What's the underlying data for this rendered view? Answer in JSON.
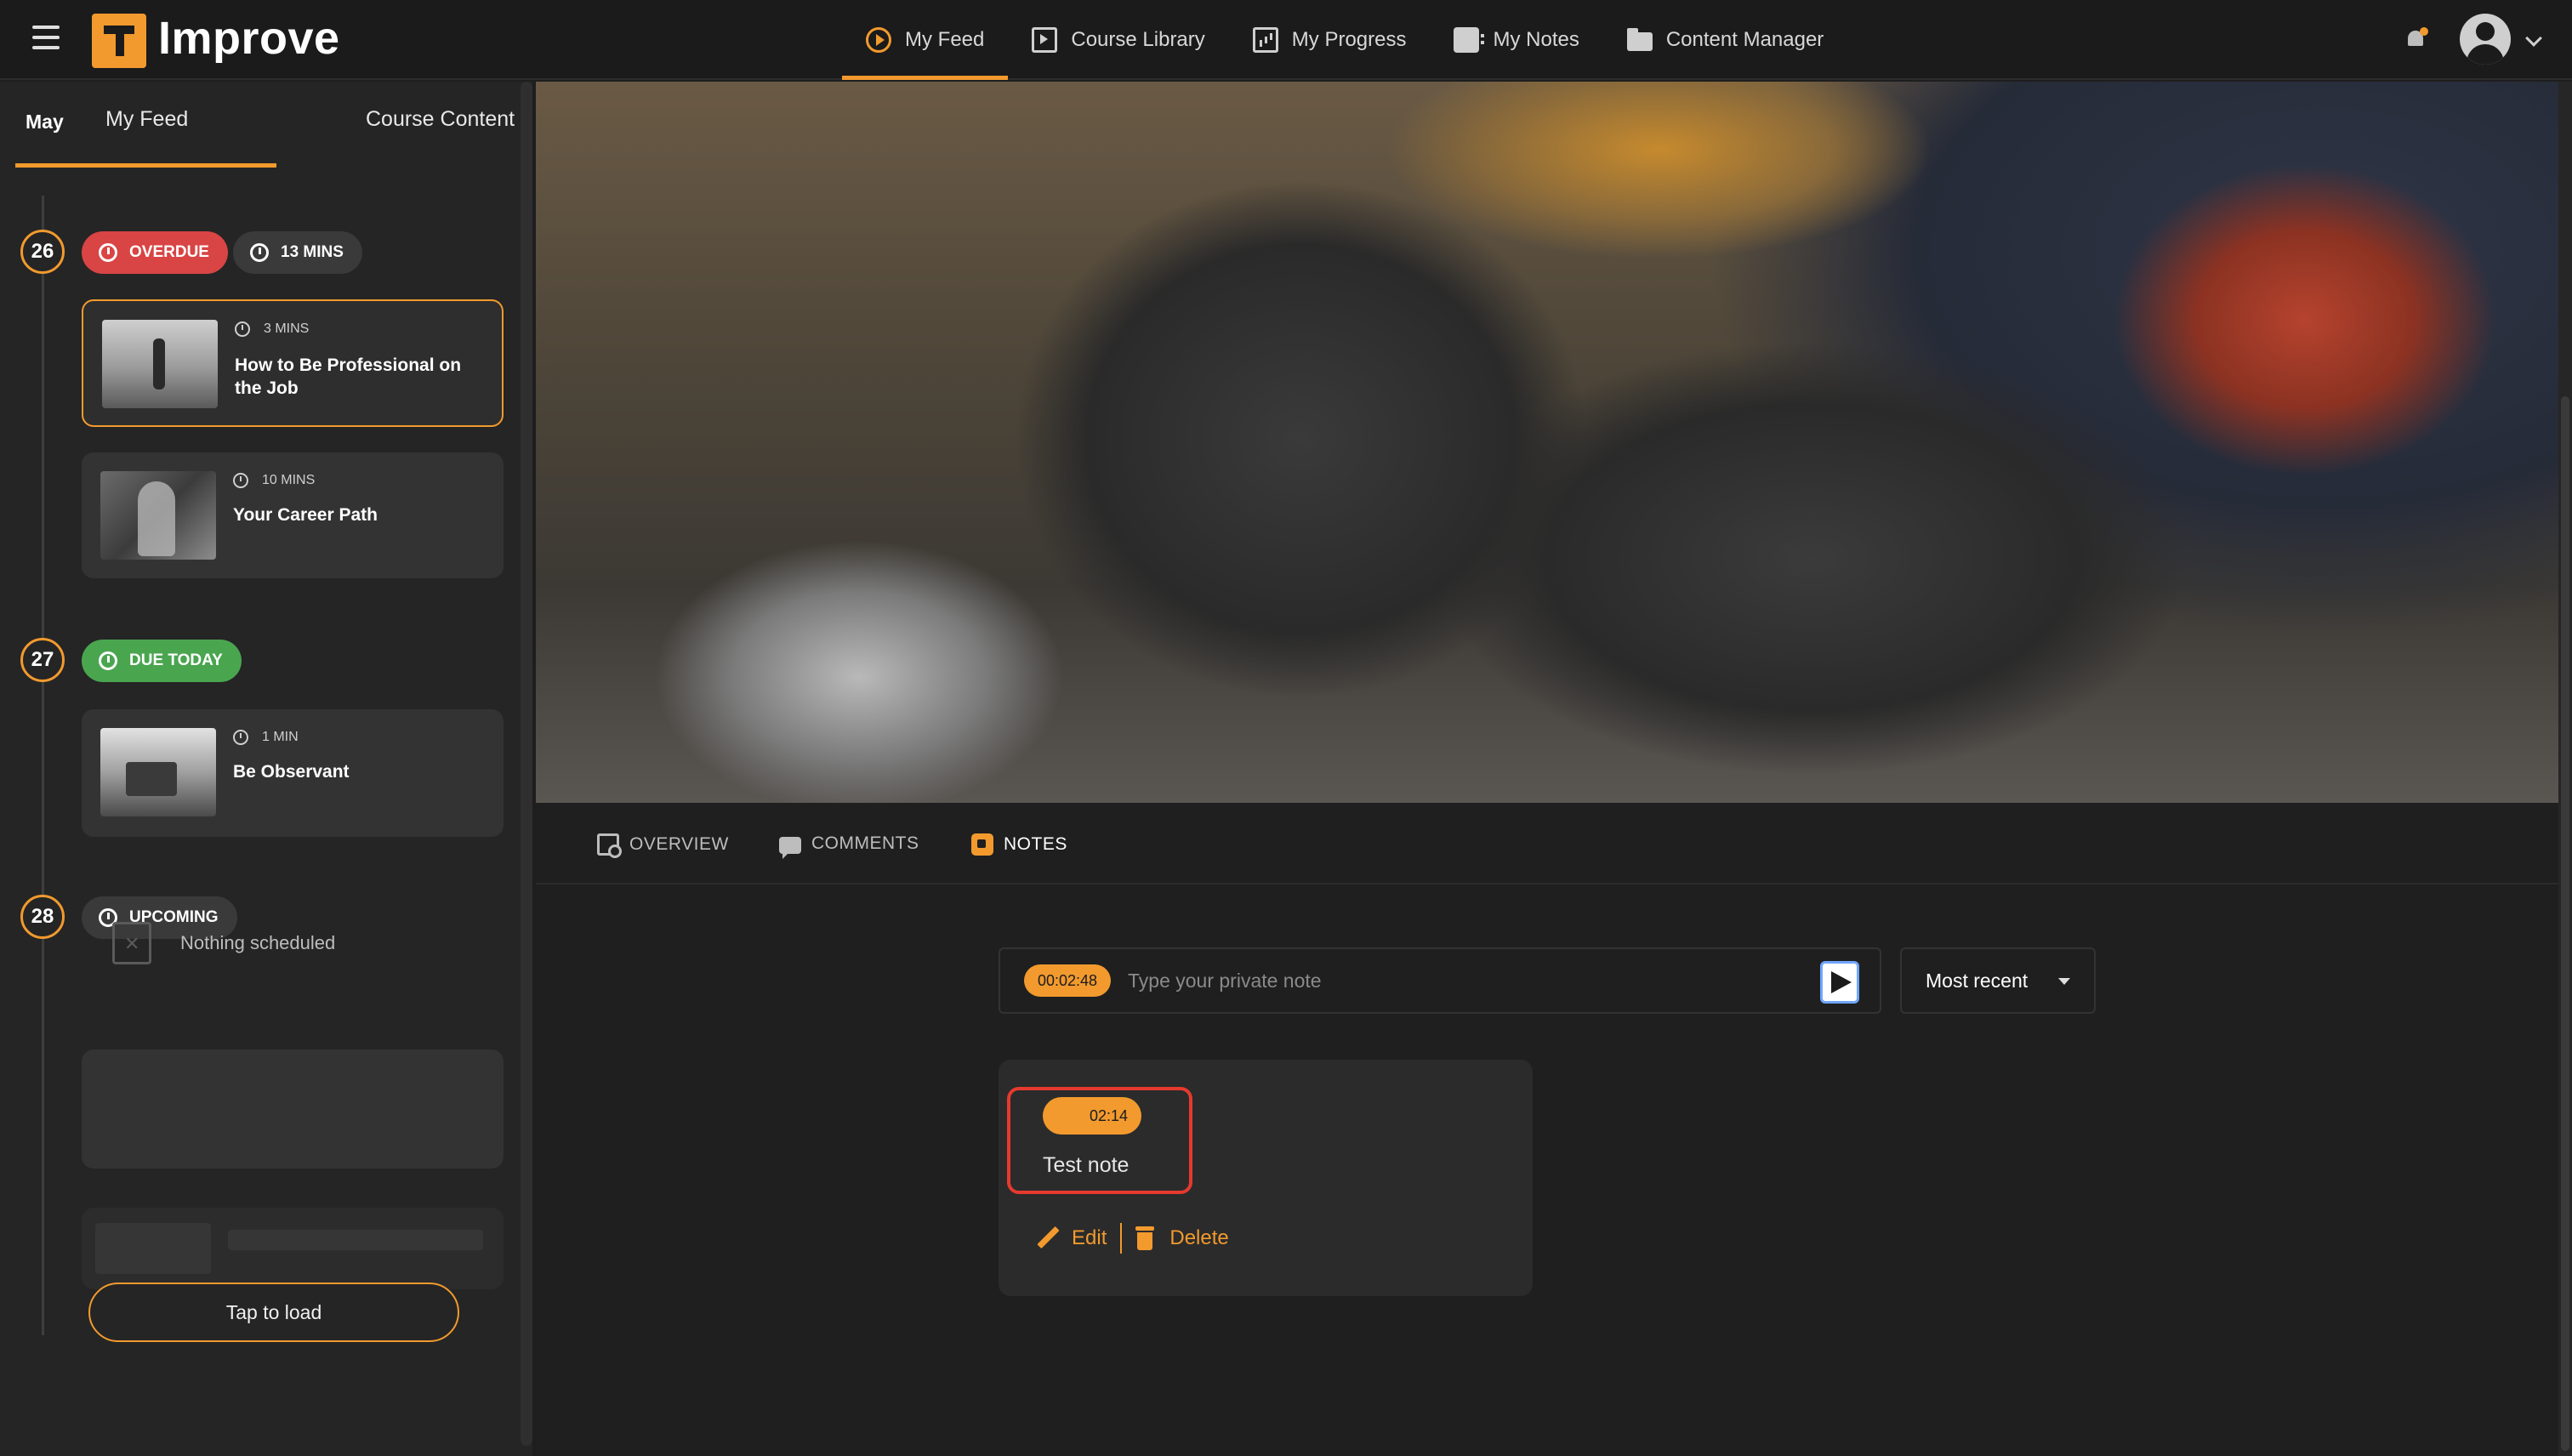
{
  "app": {
    "name": "Improve"
  },
  "nav": {
    "items": [
      {
        "label": "My Feed",
        "icon": "play-circle-icon",
        "active": true
      },
      {
        "label": "Course Library",
        "icon": "video-library-icon",
        "active": false
      },
      {
        "label": "My Progress",
        "icon": "bar-chart-icon",
        "active": false
      },
      {
        "label": "My Notes",
        "icon": "notes-icon",
        "active": false
      },
      {
        "label": "Content Manager",
        "icon": "folder-icon",
        "active": false
      }
    ]
  },
  "sidebar": {
    "tabs": [
      {
        "label": "My Feed",
        "active": true
      },
      {
        "label": "Course Content",
        "active": false
      }
    ],
    "month": "May",
    "days": [
      {
        "day": "26",
        "status": "OVERDUE",
        "duration": "13 MINS",
        "items": [
          {
            "duration": "3 MINS",
            "title": "How to Be Professional on the Job",
            "active": true
          },
          {
            "duration": "10 MINS",
            "title": "Your Career Path",
            "active": false
          }
        ]
      },
      {
        "day": "27",
        "status": "DUE TODAY",
        "items": [
          {
            "duration": "1 MIN",
            "title": "Be Observant",
            "active": false
          }
        ]
      },
      {
        "day": "28",
        "status": "UPCOMING",
        "empty_text": "Nothing scheduled"
      }
    ],
    "load_button": "Tap to load"
  },
  "lesson_tabs": [
    {
      "label": "OVERVIEW",
      "active": false
    },
    {
      "label": "COMMENTS",
      "active": false
    },
    {
      "label": "NOTES",
      "active": true
    }
  ],
  "notes": {
    "current_time": "00:02:48",
    "input_placeholder": "Type your private note",
    "sort_value": "Most recent",
    "entries": [
      {
        "time": "02:14",
        "text": "Test note",
        "edit_label": "Edit",
        "delete_label": "Delete"
      }
    ]
  },
  "colors": {
    "accent": "#f29a2e",
    "overdue": "#d94444",
    "due_today": "#4aa54f",
    "highlight": "#e63a2e"
  }
}
